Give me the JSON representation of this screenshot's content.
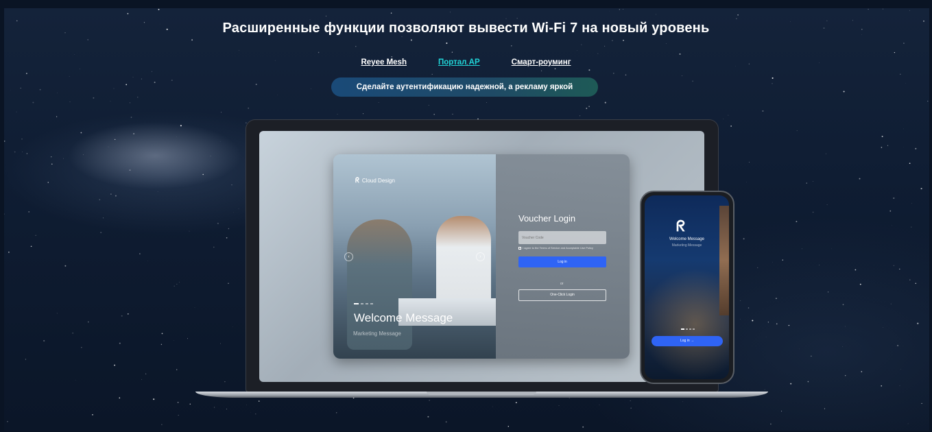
{
  "headline": "Расширенные функции позволяют вывести Wi-Fi 7 на новый уровень",
  "tabs": [
    {
      "label": "Reyee Mesh",
      "active": false
    },
    {
      "label": "Портал AP",
      "active": true
    },
    {
      "label": "Смарт-роуминг",
      "active": false
    }
  ],
  "subtitle": "Сделайте аутентификацию надежной, а рекламу яркой",
  "colors": {
    "accent": "#20d5d8",
    "button": "#2f64f5"
  },
  "laptop": {
    "brand": "Cloud Design",
    "welcome": "Welcome Message",
    "marketing": "Marketing Message",
    "login_title": "Voucher Login",
    "voucher_placeholder": "Voucher Code",
    "terms": "I agree to the Terms of Service and Acceptable Use Policy",
    "login_button": "Log in",
    "or": "or",
    "one_click": "One-Click Login"
  },
  "phone": {
    "welcome": "Welcome Message",
    "marketing": "Marketing Message",
    "login_button": "Log in →"
  }
}
